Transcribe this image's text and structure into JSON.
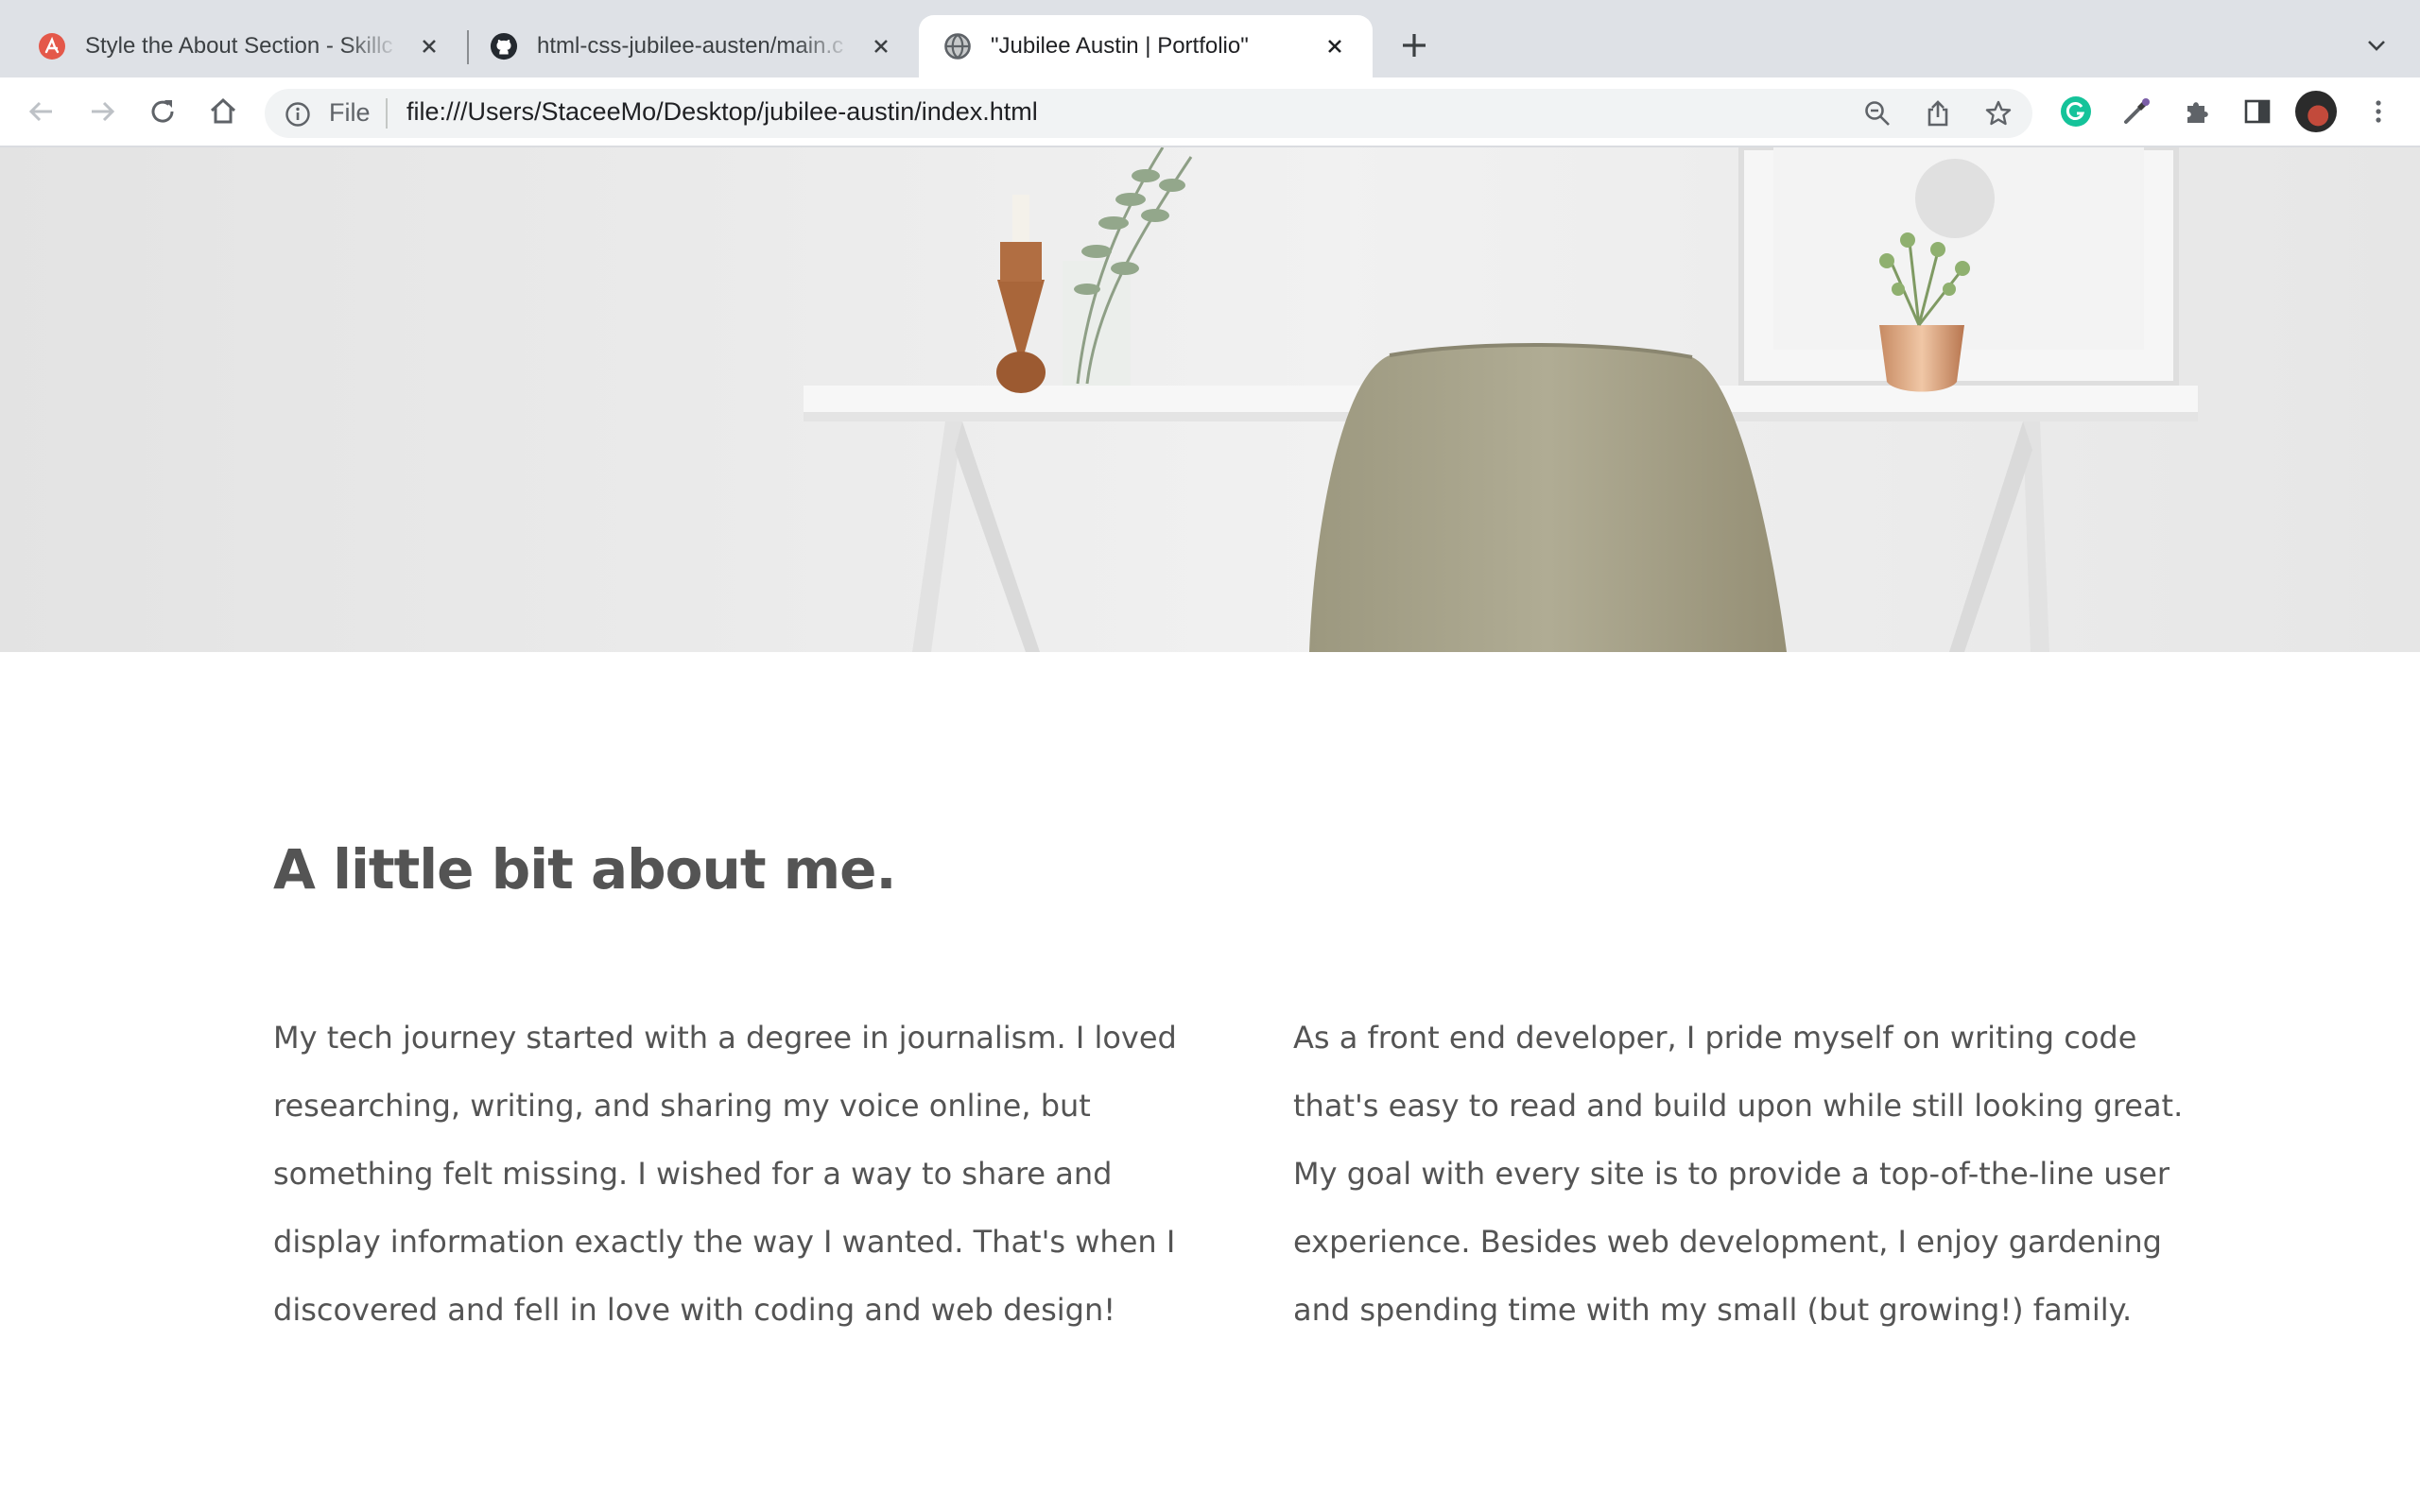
{
  "browser": {
    "tabs": [
      {
        "title": "Style the About Section - Skillc",
        "icon": "skillcrush-icon",
        "active": false
      },
      {
        "title": "html-css-jubilee-austen/main.c",
        "icon": "github-icon",
        "active": false
      },
      {
        "title": "\"Jubilee Austin | Portfolio\"",
        "icon": "globe-icon",
        "active": true
      }
    ],
    "omnibox": {
      "chip": "File",
      "url": "file:///Users/StaceeMo/Desktop/jubilee-austin/index.html"
    },
    "toolbar_icons": [
      "back-icon",
      "forward-icon",
      "reload-icon",
      "home-icon",
      "zoom-icon",
      "share-icon",
      "bookmark-star-icon",
      "grammarly-icon",
      "eyedropper-icon",
      "extensions-icon",
      "side-panel-icon",
      "profile-avatar",
      "menu-icon"
    ]
  },
  "page": {
    "hero_image": "desk-with-chair-and-plants",
    "about": {
      "heading": "A little bit about me.",
      "left_lines": [
        "My tech journey started with a degree in journalism. I loved",
        "researching, writing, and sharing my voice online, but",
        "something felt missing. I wished for a way to share and",
        "display information exactly the way I wanted. That's when I",
        "discovered and fell in love with coding and web design!"
      ],
      "right_lines": [
        "As a front end developer, I pride myself on writing code",
        "that's easy to read and build upon while still looking great.",
        "My goal with every site is to provide a top-of-the-line user",
        "experience. Besides web development, I enjoy gardening",
        "and spending time with my small (but growing!) family."
      ]
    }
  },
  "colors": {
    "tabstrip": "#dee1e6",
    "text": "#545454",
    "chair": "#a7a38a",
    "grammarly": "#15c39a"
  }
}
